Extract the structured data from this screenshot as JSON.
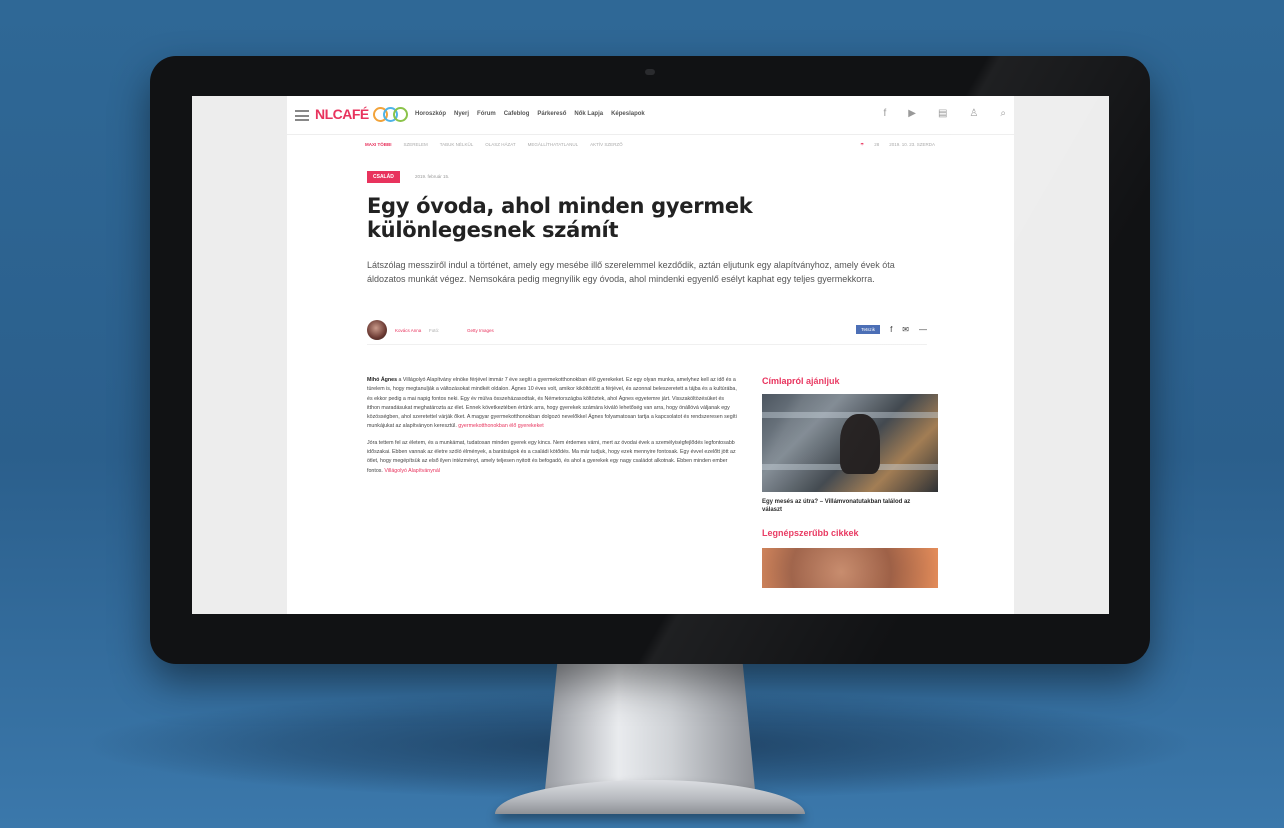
{
  "site": {
    "logo_text": "NLCAFÉ",
    "nav": [
      "Horoszkóp",
      "Nyerj",
      "Fórum",
      "Cafeblog",
      "Párkereső",
      "Nők Lapja",
      "Képeslapok"
    ],
    "subnav": [
      "MAXI TÖBBI",
      "SZERELEM",
      "TABUK NÉLKÜL",
      "OLASZ HÁZAT",
      "MEGÁLLÍTHATATLANUL",
      "AKTÍV SZERZŐ"
    ],
    "subnav_right": [
      "28",
      "2019. 10. 23. SZERDA"
    ]
  },
  "article": {
    "tag": "CSALÁD",
    "date": "2019. február 15.",
    "title": "Egy óvoda, ahol minden gyermek különlegesnek számít",
    "lead": "Látszólag messziről indul a történet, amely egy mesébe illő szerelemmel kezdődik, aztán eljutunk egy alapítványhoz, amely évek óta áldozatos munkát végez. Nemsokára pedig megnyílik egy óvoda, ahol mindenki egyenlő esélyt kaphat egy teljes gyermekkorra.",
    "author": "Kovács Anna",
    "separator": "Fotó:",
    "photo_credit": "Getty Images",
    "fb_like": "Tetszik",
    "paragraph1_lead": "Mihó Ágnes",
    "paragraph1": "a Villágolyó Alapítvány elnöke férjével immár 7 éve segíti a gyermekotthonokban élő gyerekeket. Ez egy olyan munka, amelyhez kell az idő és a türelem is, hogy megtanulják a változásokat mindkét oldalon. Ágnes 10 éves volt, amikor kiköltözött a férjével, és azonnal beleszeretett a tájba és a kultúrába, és ekkor pedig a mai napig fontos neki. Egy év múlva összeházasodtak, és Németországba költöztek, ahol Ágnes egyetemre járt. Visszaköltözésüket és itthon maradásukat meghatározta az élet. Ennek következtében értünk arra, hogy gyerekek számára kiváló lehetőség van arra, hogy önállóvá váljanak egy közösségben, ahol szeretettel várják őket. A magyar gyermekotthonokban dolgozó nevelőkkel Ágnes folyamatosan tartja a kapcsolatot és rendszeresen segíti munkájukat az alapítványon keresztül.",
    "paragraph1_link": "gyermekotthonokban élő gyerekeket",
    "paragraph2": "Jóra tettem fel az életem, és a munkámat, tudatosan minden gyerek egy kincs. Nem érdemes várni, mert az óvodai évek a személyiségfejlődés legfontosabb időszakai. Ebben vannak az életre szóló élmények, a barátságok és a családi kötődés. Ma már tudjuk, hogy ezek mennyire fontosak. Egy évvel ezelőtt jött az ötlet, hogy megépítsük az első ilyen intézményt, amely teljesen nyitott és befogadó, és ahol a gyerekek egy nagy családot alkotnak. Ebben minden ember fontos.",
    "paragraph2_link": "Villágolyó Alapítványnál"
  },
  "sidebar": {
    "section1_title": "Címlapról ajánljuk",
    "caption1": "Egy mesés az útra? – Villámvonatutakban találod az választ",
    "section2_title": "Legnépszerűbb cikkek"
  }
}
